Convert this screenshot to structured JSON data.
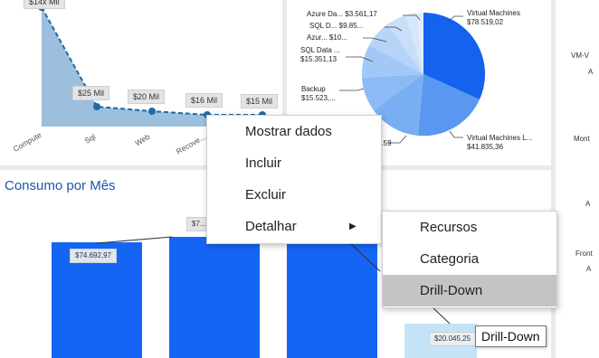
{
  "top_line_chart": {
    "data_labels": [
      "$25 Mil",
      "$20 Mil",
      "$16 Mil",
      "$15 Mil"
    ],
    "top_label_cut": "$14x Mil",
    "categories": [
      "Compute",
      "Sql",
      "Web",
      "Recove..."
    ]
  },
  "pie_chart": {
    "labels": [
      {
        "name": "Azure Da...",
        "value": "$3.561,17"
      },
      {
        "name": "SQL D...",
        "value": "$9.85..."
      },
      {
        "name": "Azur...",
        "value": "$10..."
      },
      {
        "name": "SQL Data ...",
        "value": "$15.351,13"
      },
      {
        "name": "Backup",
        "value": "$15.523,..."
      },
      {
        "name": "",
        "value": "...59"
      },
      {
        "name": "Virtual Machines",
        "value": "$78.519,02"
      },
      {
        "name": "Virtual Machines L...",
        "value": "$41.835,36"
      }
    ]
  },
  "right_panel": {
    "labels": [
      "VM-V",
      "A",
      "Mont",
      "A",
      "Front",
      "A"
    ]
  },
  "bar_section": {
    "title": "Consumo por Mês",
    "bar_labels": [
      "$74.692,97",
      "$7...",
      "$20.045,25"
    ]
  },
  "chart_data": [
    {
      "type": "area",
      "categories": [
        "Compute",
        "Sql",
        "Web",
        "Recove...",
        ""
      ],
      "values": [
        140,
        25,
        20,
        16,
        15
      ],
      "xlabel": "",
      "ylabel": ""
    },
    {
      "type": "pie",
      "categories": [
        "Virtual Machines",
        "Virtual Machines L...",
        "Backup",
        "SQL Data ...",
        "Azur...",
        "SQL D...",
        "Azure Da..."
      ],
      "values": [
        78519.02,
        41835.36,
        15523,
        15351.13,
        10000,
        9850,
        3561.17
      ]
    },
    {
      "type": "bar",
      "categories": [
        "",
        "",
        "",
        ""
      ],
      "values": [
        74692.97,
        78000,
        76000,
        20045.25
      ]
    }
  ],
  "context_menu": {
    "items": [
      "Mostrar dados",
      "Incluir",
      "Excluir",
      "Detalhar"
    ]
  },
  "submenu": {
    "items": [
      "Recursos",
      "Categoria",
      "Drill-Down"
    ]
  },
  "tooltip": {
    "text": "Drill-Down"
  },
  "colors": {
    "area_fill": "#9bbfdc",
    "line": "#1c6aa6",
    "bar": "#1565f5",
    "pie_main": "#1462ee"
  }
}
